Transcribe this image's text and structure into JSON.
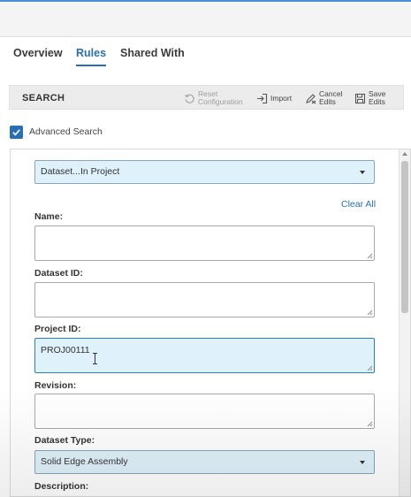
{
  "tabs": [
    {
      "label": "Overview"
    },
    {
      "label": "Rules"
    },
    {
      "label": "Shared With"
    }
  ],
  "toolbar": {
    "title": "SEARCH",
    "reset_line1": "Reset",
    "reset_line2": "Configuration",
    "import_label": "Import",
    "cancel_line1": "Cancel",
    "cancel_line2": "Edits",
    "save_line1": "Save",
    "save_line2": "Edits"
  },
  "advanced_search": {
    "label": "Advanced Search",
    "checked": true
  },
  "form": {
    "search_type": "Dataset...In Project",
    "clear_all": "Clear All",
    "name_label": "Name:",
    "name_value": "",
    "dataset_id_label": "Dataset ID:",
    "dataset_id_value": "",
    "project_id_label": "Project ID:",
    "project_id_value": "PROJ00111",
    "revision_label": "Revision:",
    "revision_value": "",
    "dataset_type_label": "Dataset Type:",
    "dataset_type_value": "Solid Edge Assembly",
    "description_label": "Description:"
  },
  "colors": {
    "accent": "#2a6fb5",
    "field_focus_bg": "#dff1fa"
  }
}
